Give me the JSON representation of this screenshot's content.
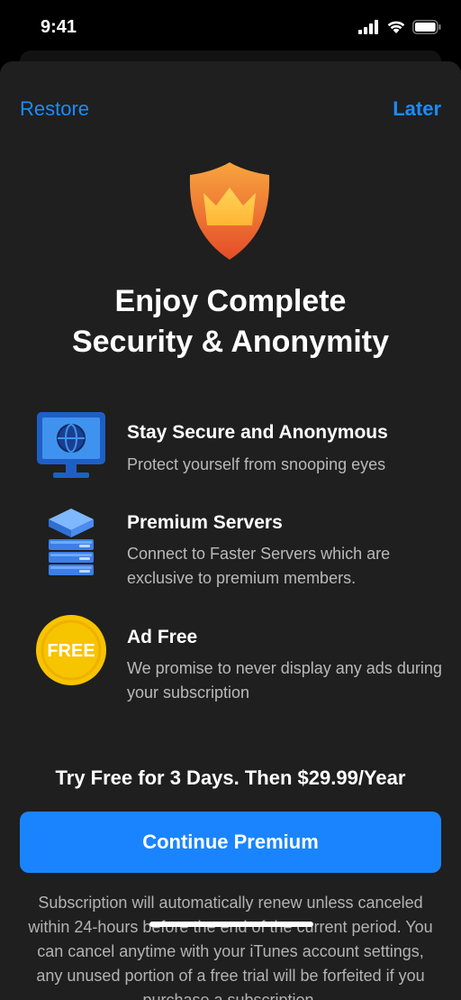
{
  "status": {
    "time": "9:41",
    "icons": [
      "cellular-signal-icon",
      "wifi-icon",
      "battery-icon"
    ]
  },
  "nav": {
    "restore": "Restore",
    "later": "Later"
  },
  "hero": {
    "icon": "shield-crown-icon",
    "title_line1": "Enjoy Complete",
    "title_line2": "Security & Anonymity"
  },
  "features": [
    {
      "icon": "monitor-globe-icon",
      "title": "Stay Secure and Anonymous",
      "description": "Protect yourself from snooping eyes"
    },
    {
      "icon": "server-stack-icon",
      "title": "Premium Servers",
      "description": "Connect to Faster Servers which are exclusive to premium members."
    },
    {
      "icon": "free-coin-icon",
      "badge": "FREE",
      "title": "Ad Free",
      "description": "We promise to never display any ads during your subscription"
    }
  ],
  "offer": {
    "trial_text": "Try Free for 3 Days. Then $29.99/Year",
    "cta_label": "Continue Premium"
  },
  "legal": {
    "text": "Subscription will automatically renew unless canceled within 24-hours before the end of the current period. You can cancel anytime with your iTunes account settings, any unused portion of a free trial will be forfeited if you purchase a subscription."
  },
  "colors": {
    "accent": "#1a84ff",
    "sheet_background": "#1f1f1f",
    "shield_top": "#f59a3a",
    "shield_bottom": "#e8532a",
    "coin": "#f7c400"
  }
}
